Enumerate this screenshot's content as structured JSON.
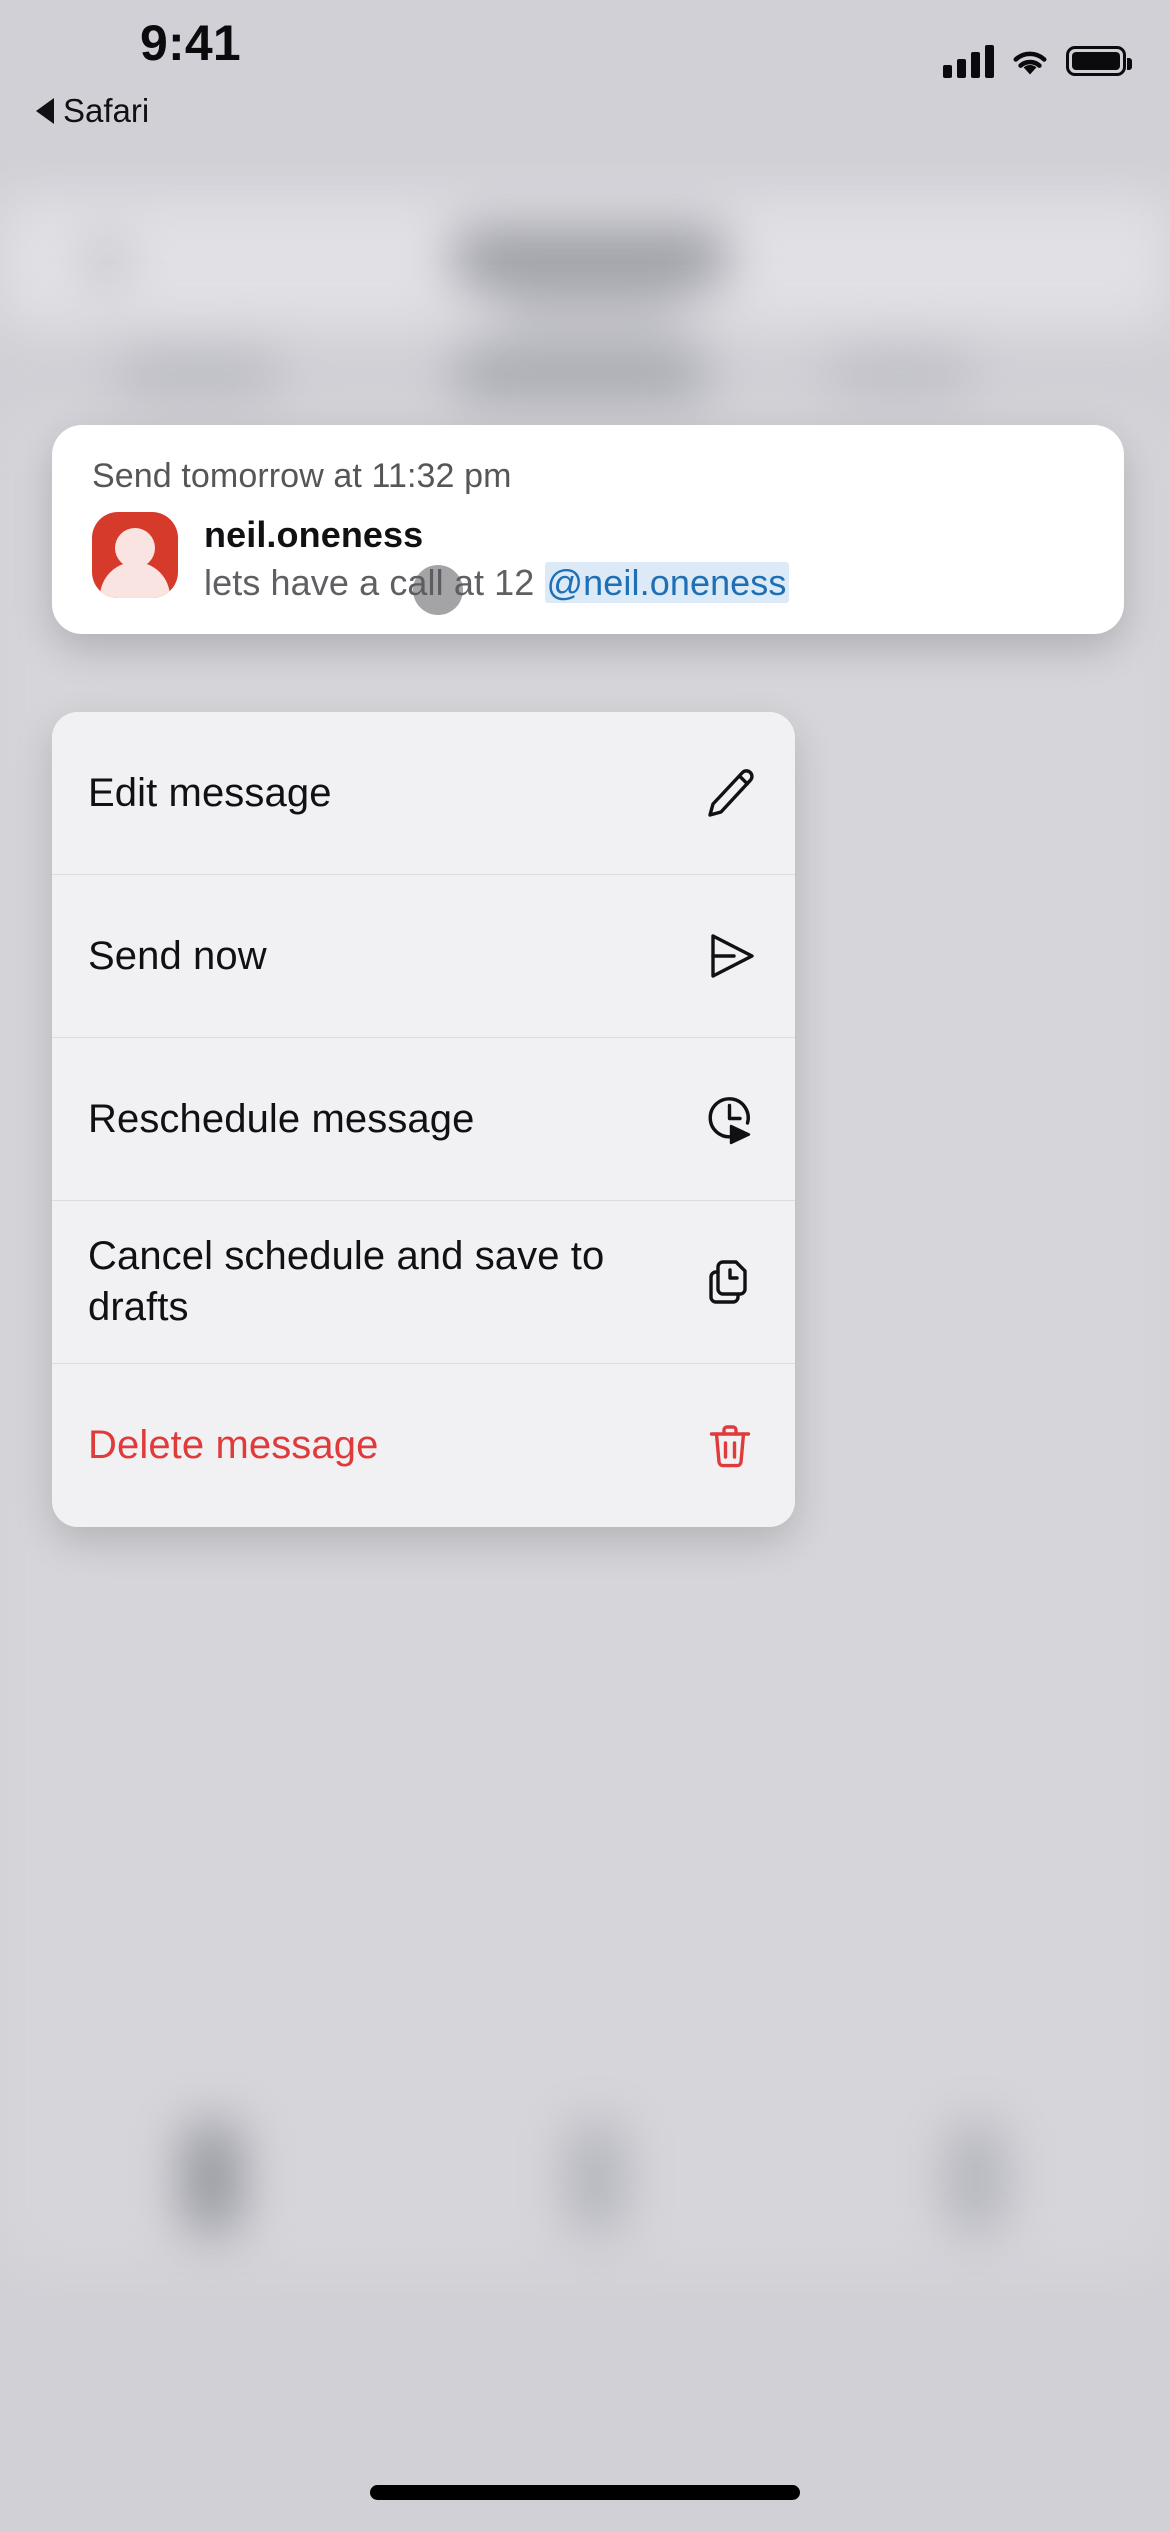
{
  "status_bar": {
    "time": "9:41",
    "cellular_icon": "cellular-bars-icon",
    "wifi_icon": "wifi-icon",
    "battery_icon": "battery-full-icon"
  },
  "back_to_app": {
    "label": "Safari",
    "icon": "back-triangle-icon"
  },
  "scheduled_card": {
    "schedule_label": "Send tomorrow at 11:32 pm",
    "avatar_icon": "user-avatar-icon",
    "avatar_color": "#d63a2a",
    "username": "neil.oneness",
    "message_text": "lets have a call at 12 ",
    "message_mention": "@neil.oneness",
    "mention_color": "#1e6fb5",
    "mention_highlight": "#dbeaf6"
  },
  "touch_indicator": {
    "name": "touch-point-indicator"
  },
  "action_menu": {
    "items": [
      {
        "label": "Edit message",
        "icon": "pencil-icon",
        "danger": false
      },
      {
        "label": "Send now",
        "icon": "send-icon",
        "danger": false
      },
      {
        "label": "Reschedule message",
        "icon": "clock-arrow-icon",
        "danger": false
      },
      {
        "label": "Cancel schedule and save to drafts",
        "icon": "copy-clock-icon",
        "danger": false
      },
      {
        "label": "Delete message",
        "icon": "trash-icon",
        "danger": true
      }
    ],
    "danger_color": "#e03b3b",
    "background_color": "#f1f1f4"
  },
  "home_indicator": {
    "name": "home-indicator"
  }
}
